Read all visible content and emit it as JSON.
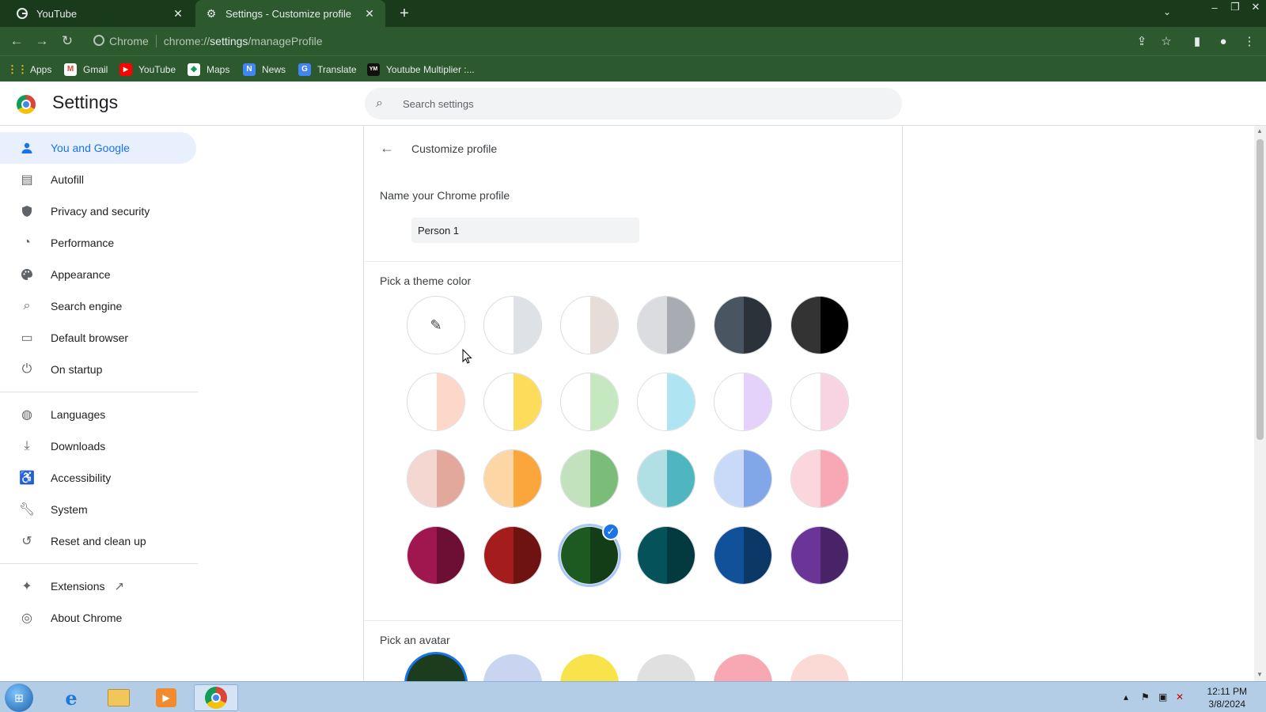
{
  "tabs": [
    {
      "label": "YouTube",
      "icon": "google-g-icon",
      "active": false
    },
    {
      "label": "Settings - Customize profile",
      "icon": "gear-icon",
      "active": true
    }
  ],
  "toolbar": {
    "chip": "Chrome",
    "url_prefix": "chrome://",
    "url_path": "settings",
    "url_suffix": "/manageProfile"
  },
  "bookmarks": [
    {
      "label": "Apps",
      "icon": "apps-grid-icon"
    },
    {
      "label": "Gmail",
      "icon": "gmail-icon"
    },
    {
      "label": "YouTube",
      "icon": "youtube-icon"
    },
    {
      "label": "Maps",
      "icon": "maps-icon"
    },
    {
      "label": "News",
      "icon": "news-icon"
    },
    {
      "label": "Translate",
      "icon": "translate-icon"
    },
    {
      "label": "Youtube Multiplier :...",
      "icon": "ym-icon",
      "icon_text": "YM"
    }
  ],
  "settings": {
    "title": "Settings",
    "search_placeholder": "Search settings"
  },
  "sidebar": {
    "items": [
      {
        "label": "You and Google",
        "icon": "person-icon",
        "selected": true
      },
      {
        "label": "Autofill",
        "icon": "clipboard-icon"
      },
      {
        "label": "Privacy and security",
        "icon": "shield-icon"
      },
      {
        "label": "Performance",
        "icon": "speedometer-icon"
      },
      {
        "label": "Appearance",
        "icon": "palette-icon"
      },
      {
        "label": "Search engine",
        "icon": "search-icon"
      },
      {
        "label": "Default browser",
        "icon": "browser-window-icon"
      },
      {
        "label": "On startup",
        "icon": "power-icon"
      },
      {
        "label": "Languages",
        "icon": "globe-icon"
      },
      {
        "label": "Downloads",
        "icon": "download-icon"
      },
      {
        "label": "Accessibility",
        "icon": "accessibility-icon"
      },
      {
        "label": "System",
        "icon": "wrench-icon"
      },
      {
        "label": "Reset and clean up",
        "icon": "history-icon"
      },
      {
        "label": "Extensions",
        "icon": "puzzle-icon"
      },
      {
        "label": "About Chrome",
        "icon": "chrome-icon"
      }
    ]
  },
  "main": {
    "page_title": "Customize profile",
    "name_label": "Name your Chrome profile",
    "name_value": "Person 1",
    "theme_label": "Pick a theme color",
    "avatar_label": "Pick an avatar",
    "theme_colors": [
      [
        "picker",
        "#ffffff|#dee1e6",
        "#ffffff|#e6ddd9",
        "#dadce0|#a9abb2",
        "#4a5562|#2b323a",
        "#333333|#000000"
      ],
      [
        "#ffffff|#fdd7c7",
        "#ffffff|#fddc5c",
        "#ffffff|#c6e8c1",
        "#ffffff|#afe5f2",
        "#ffffff|#e4d2fa",
        "#ffffff|#f8d3e1"
      ],
      [
        "#f4d7d0|#e2a89b",
        "#fcd6a4|#faa63a",
        "#c2e1bd|#7bbc78",
        "#b0e0e3|#4fb6c0",
        "#c9d9f8|#81a7e8",
        "#fcd6dd|#f8a8b5"
      ],
      [
        "#a0174f|#6d0f35",
        "#a51c1c|#6e1212",
        "#1d5a22|#133d17",
        "#06525a|#033a40",
        "#11519a|#0b3866",
        "#6a3597|#482368"
      ]
    ],
    "selected_color": {
      "row": 3,
      "col": 2
    },
    "avatars": [
      "#1b3d1e",
      "#c9d4f0",
      "#f8e44a",
      "#e0e0e0",
      "#f7a8b2",
      "#fbd9d4"
    ]
  },
  "taskbar": {
    "time": "12:11 PM",
    "date": "3/8/2024",
    "apps": [
      "start-orb-icon",
      "internet-explorer-icon",
      "file-explorer-icon",
      "media-player-icon",
      "chrome-icon"
    ]
  }
}
